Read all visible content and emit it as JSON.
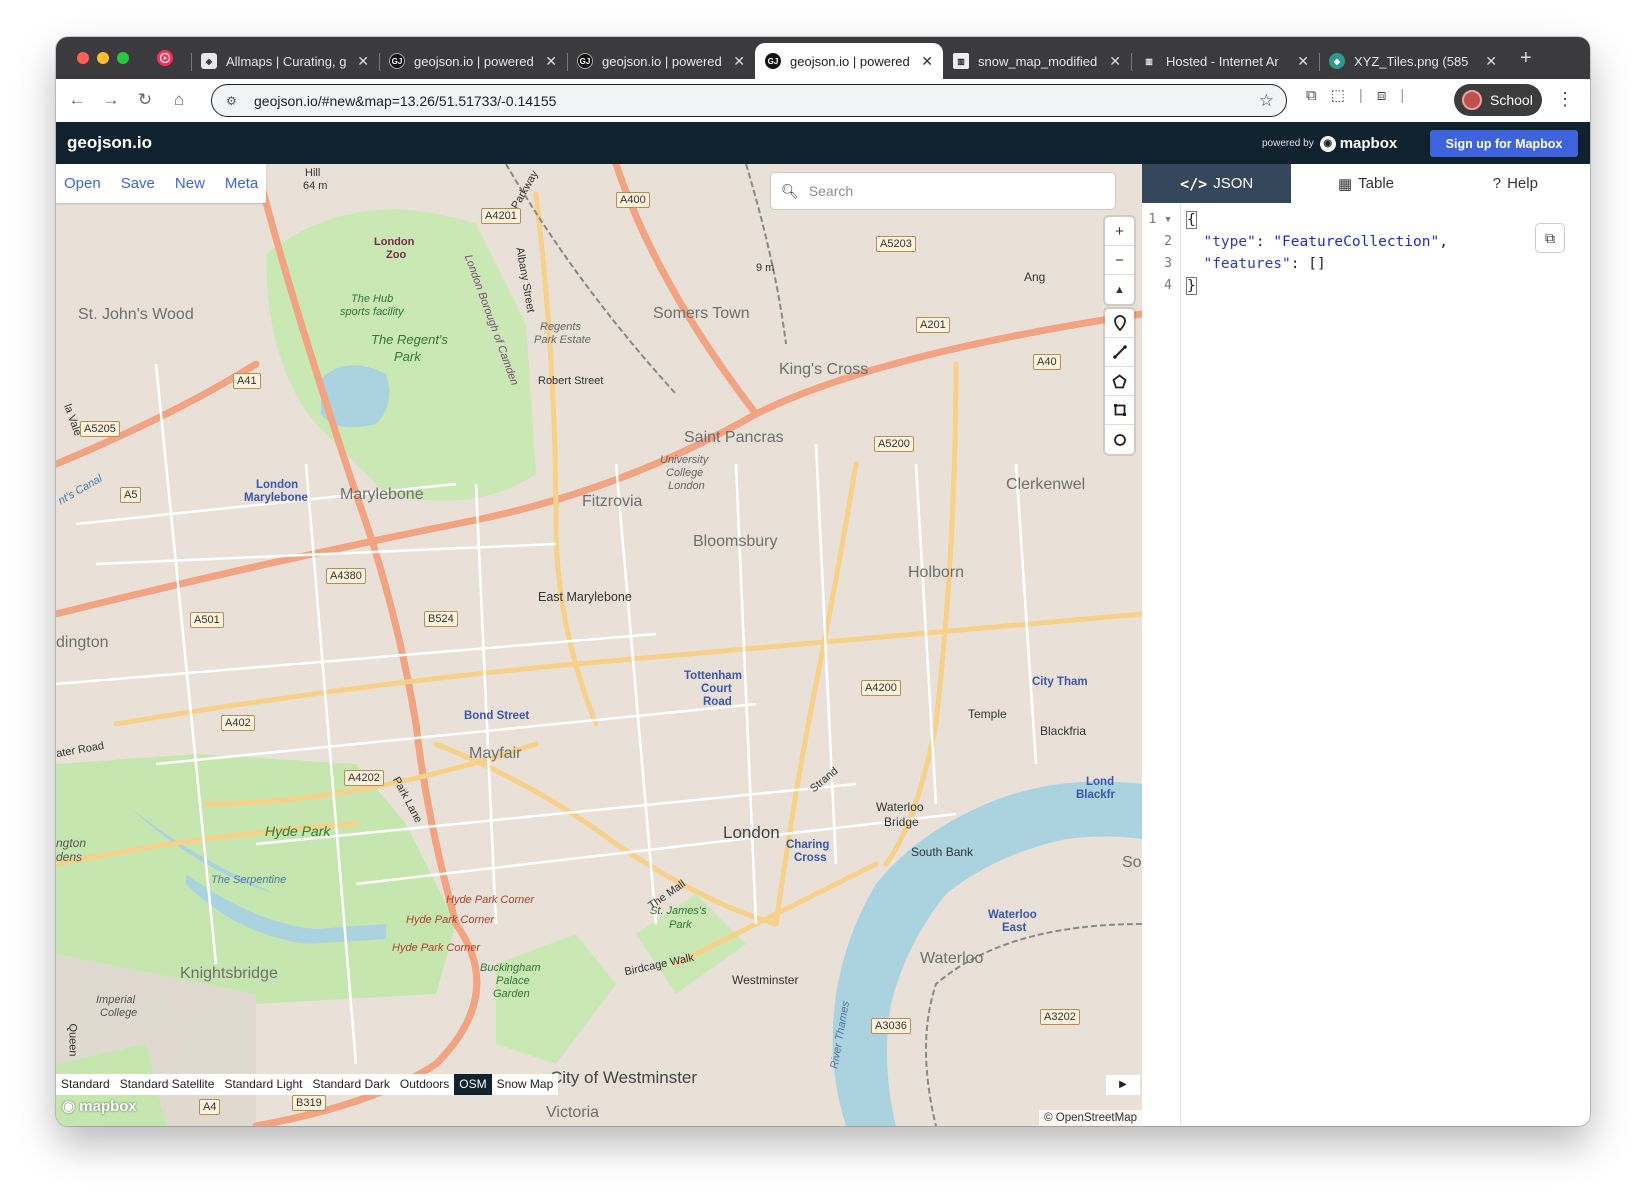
{
  "browser": {
    "tabs": [
      {
        "title": "Allmaps | Curating, g",
        "favicon": "cube-icon",
        "active": false
      },
      {
        "title": "geojson.io | powered",
        "favicon": "geojson-icon",
        "active": false
      },
      {
        "title": "geojson.io | powered",
        "favicon": "geojson-icon",
        "active": false
      },
      {
        "title": "geojson.io | powered",
        "favicon": "geojson-icon",
        "active": true
      },
      {
        "title": "snow_map_modified",
        "favicon": "museum-icon",
        "active": false
      },
      {
        "title": "Hosted - Internet Ar",
        "favicon": "archive-icon",
        "active": false
      },
      {
        "title": "XYZ_Tiles.png (585",
        "favicon": "tiles-icon",
        "active": false
      }
    ],
    "url": "geojson.io/#new&map=13.26/51.51733/-0.14155",
    "profile_label": "School"
  },
  "app": {
    "logo": "geojson.io",
    "powered_by": "powered by",
    "mapbox": "mapbox",
    "signup": "Sign up for Mapbox",
    "accent": "#3e63dd",
    "header_bg": "#10222d"
  },
  "file_menu": {
    "open": "Open",
    "save": "Save",
    "new": "New",
    "meta": "Meta"
  },
  "search": {
    "placeholder": "Search"
  },
  "map": {
    "layers": [
      "Standard",
      "Standard Satellite",
      "Standard Light",
      "Standard Dark",
      "Outdoors",
      "OSM",
      "Snow Map"
    ],
    "active_layer": "OSM",
    "attribution": "© OpenStreetMap",
    "logo": "mapbox",
    "labels": {
      "hill": "Hill",
      "hill_elev": "64 m",
      "london_zoo": "London",
      "london_zoo2": "Zoo",
      "st_johns_wood": "St. John's Wood",
      "the_hub": "The Hub",
      "the_hub2": "sports facility",
      "regents_park": "The Regent's",
      "regents_park2": "Park",
      "regents_estate": "Regents",
      "regents_estate2": "Park Estate",
      "robert_street": "Robert Street",
      "somers_town": "Somers Town",
      "kings_cross": "King's Cross",
      "saint_pancras": "Saint Pancras",
      "ucl": "University",
      "ucl2": "College",
      "ucl3": "London",
      "london_marylebone": "London",
      "london_marylebone2": "Marylebone",
      "marylebone": "Marylebone",
      "fitzrovia": "Fitzrovia",
      "bloomsbury": "Bloomsbury",
      "clerkenwell": "Clerkenwel",
      "holborn": "Holborn",
      "east_marylebone": "East Marylebone",
      "paddington": "dington",
      "tottenham": "Tottenham",
      "tottenham2": "Court",
      "tottenham3": "Road",
      "bond_street": "Bond Street",
      "mayfair": "Mayfair",
      "temple": "Temple",
      "blackfriars": "Blackfria",
      "city_thames": "City Tham",
      "water_road": "ater Road",
      "hyde_park": "Hyde Park",
      "the_serpentine": "The Serpentine",
      "hyde_park_corner": "Hyde Park Corner",
      "hyde_park_corner2": "Hyde Park Corner",
      "hyde_park_corner3": "Hyde Park Corner",
      "waterloo_bridge": "Waterloo",
      "waterloo_bridge2": "Bridge",
      "london": "London",
      "charing_cross": "Charing",
      "charing_cross2": "Cross",
      "south_bank": "South Bank",
      "waterloo_east": "Waterloo",
      "waterloo_east2": "East",
      "waterloo": "Waterloo",
      "knightsbridge": "Knightsbridge",
      "imperial": "Imperial",
      "imperial2": "College",
      "st_james_park": "St. James's",
      "st_james_park2": "Park",
      "the_mall": "The Mall",
      "buckingham": "Buckingham",
      "buckingham2": "Palace",
      "buckingham3": "Garden",
      "birdcage_walk": "Birdcage Walk",
      "westminster": "Westminster",
      "city_westminster": "City of Westminster",
      "river_thames": "River Thames",
      "strand": "Strand",
      "park_lane": "Park Lane",
      "london_borough": "London Borough of Camden",
      "albany_street": "Albany Street",
      "parkway": "Parkway",
      "kensington_gardens": "ngton",
      "kensington_gardens2": "dens",
      "lond_blackfr": "Lond",
      "lond_blackfr2": "Blackfr",
      "ang": "Ang",
      "so": "So",
      "queen": "Queen",
      "victoria": "Victoria",
      "maida_vale": "la Vale",
      "canal": "nt's Canal",
      "m9": "9 m"
    },
    "shields": {
      "a4201": "A4201",
      "a400": "A400",
      "a5203": "A5203",
      "a201": "A201",
      "a41": "A41",
      "a5205": "A5205",
      "a5": "A5",
      "a5200": "A5200",
      "a4380": "A4380",
      "a501": "A501",
      "b524": "B524",
      "a4200": "A4200",
      "a402": "A402",
      "a4202": "A4202",
      "a3036": "A3036",
      "a3202": "A3202",
      "a4": "A4",
      "b319": "B319",
      "a40": "A40"
    }
  },
  "panel": {
    "tabs": [
      {
        "label": "JSON",
        "icon": "code-icon"
      },
      {
        "label": "Table",
        "icon": "table-icon"
      },
      {
        "label": "Help",
        "icon": "help-icon"
      }
    ],
    "active_tab": "JSON",
    "lines": [
      "1",
      "2",
      "3",
      "4"
    ],
    "code": {
      "open": "{",
      "type_key": "\"type\"",
      "type_val": "\"FeatureCollection\"",
      "features_key": "\"features\"",
      "features_val": "[]",
      "close": "}"
    }
  }
}
